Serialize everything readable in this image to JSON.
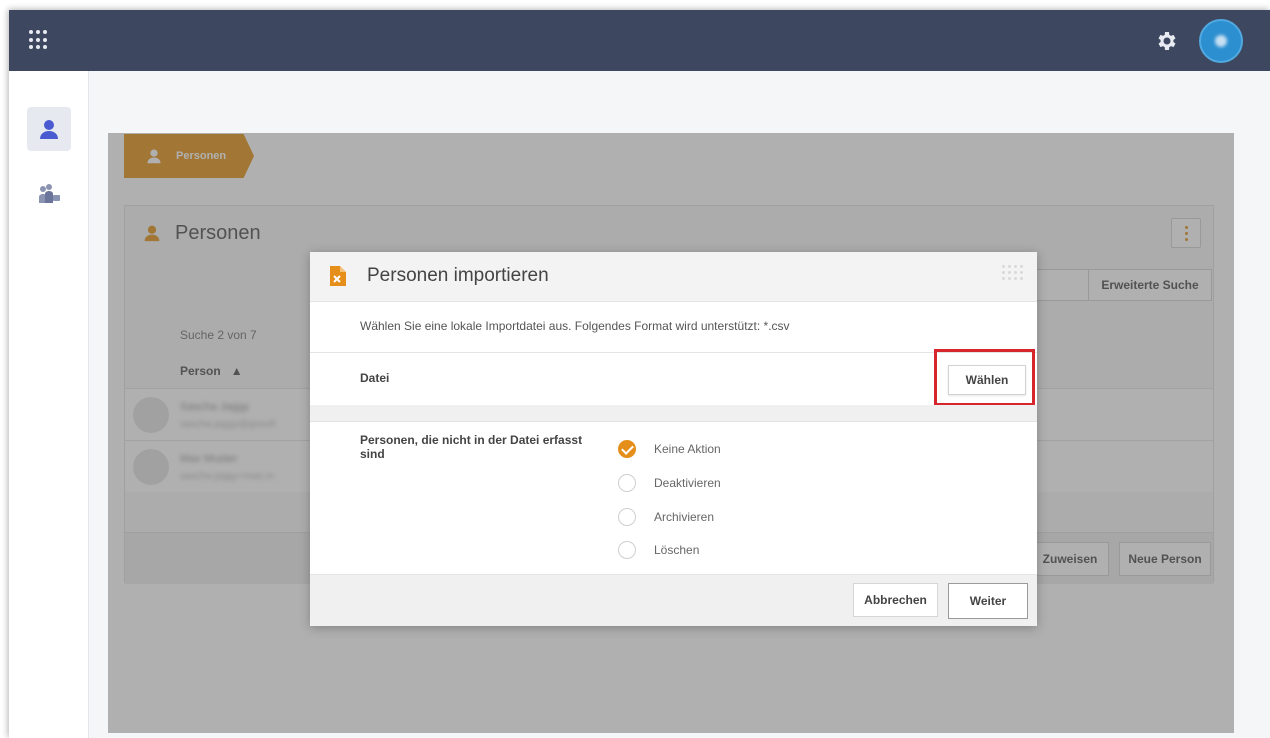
{
  "breadcrumb": {
    "label": "Personen"
  },
  "panel": {
    "title": "Personen",
    "adv_search_label": "Erweiterte Suche",
    "result_count": "Suche 2 von 7",
    "column_person": "Person",
    "sort_indicator": "▲",
    "rows": [
      {
        "name": "Sascha Jaggy",
        "email": "sascha.jaggy@grisoft"
      },
      {
        "name": "Max Muster",
        "email": "sascha.jaggy+max.m"
      }
    ],
    "assign_label": "Zuweisen",
    "new_person_label": "Neue Person"
  },
  "modal": {
    "title": "Personen importieren",
    "info": "Wählen Sie eine lokale Importdatei aus. Folgendes Format wird unterstützt: *.csv",
    "file_label": "Datei",
    "choose_label": "Wählen",
    "persons_label": "Personen, die nicht in der Datei erfasst sind",
    "options": [
      {
        "label": "Keine Aktion",
        "checked": true
      },
      {
        "label": "Deaktivieren",
        "checked": false
      },
      {
        "label": "Archivieren",
        "checked": false
      },
      {
        "label": "Löschen",
        "checked": false
      }
    ],
    "cancel_label": "Abbrechen",
    "next_label": "Weiter"
  },
  "colors": {
    "topbar": "#3d475f",
    "accent": "#e59620",
    "sidebar_active_icon": "#4a5bd1",
    "highlight": "#d6262b"
  },
  "icons": {
    "topbar": [
      "apps-grid-icon",
      "gear-icon"
    ],
    "sidebar": [
      "person-icon",
      "group-icon"
    ],
    "modal": [
      "csv-file-icon",
      "drag-handle-icon"
    ]
  }
}
